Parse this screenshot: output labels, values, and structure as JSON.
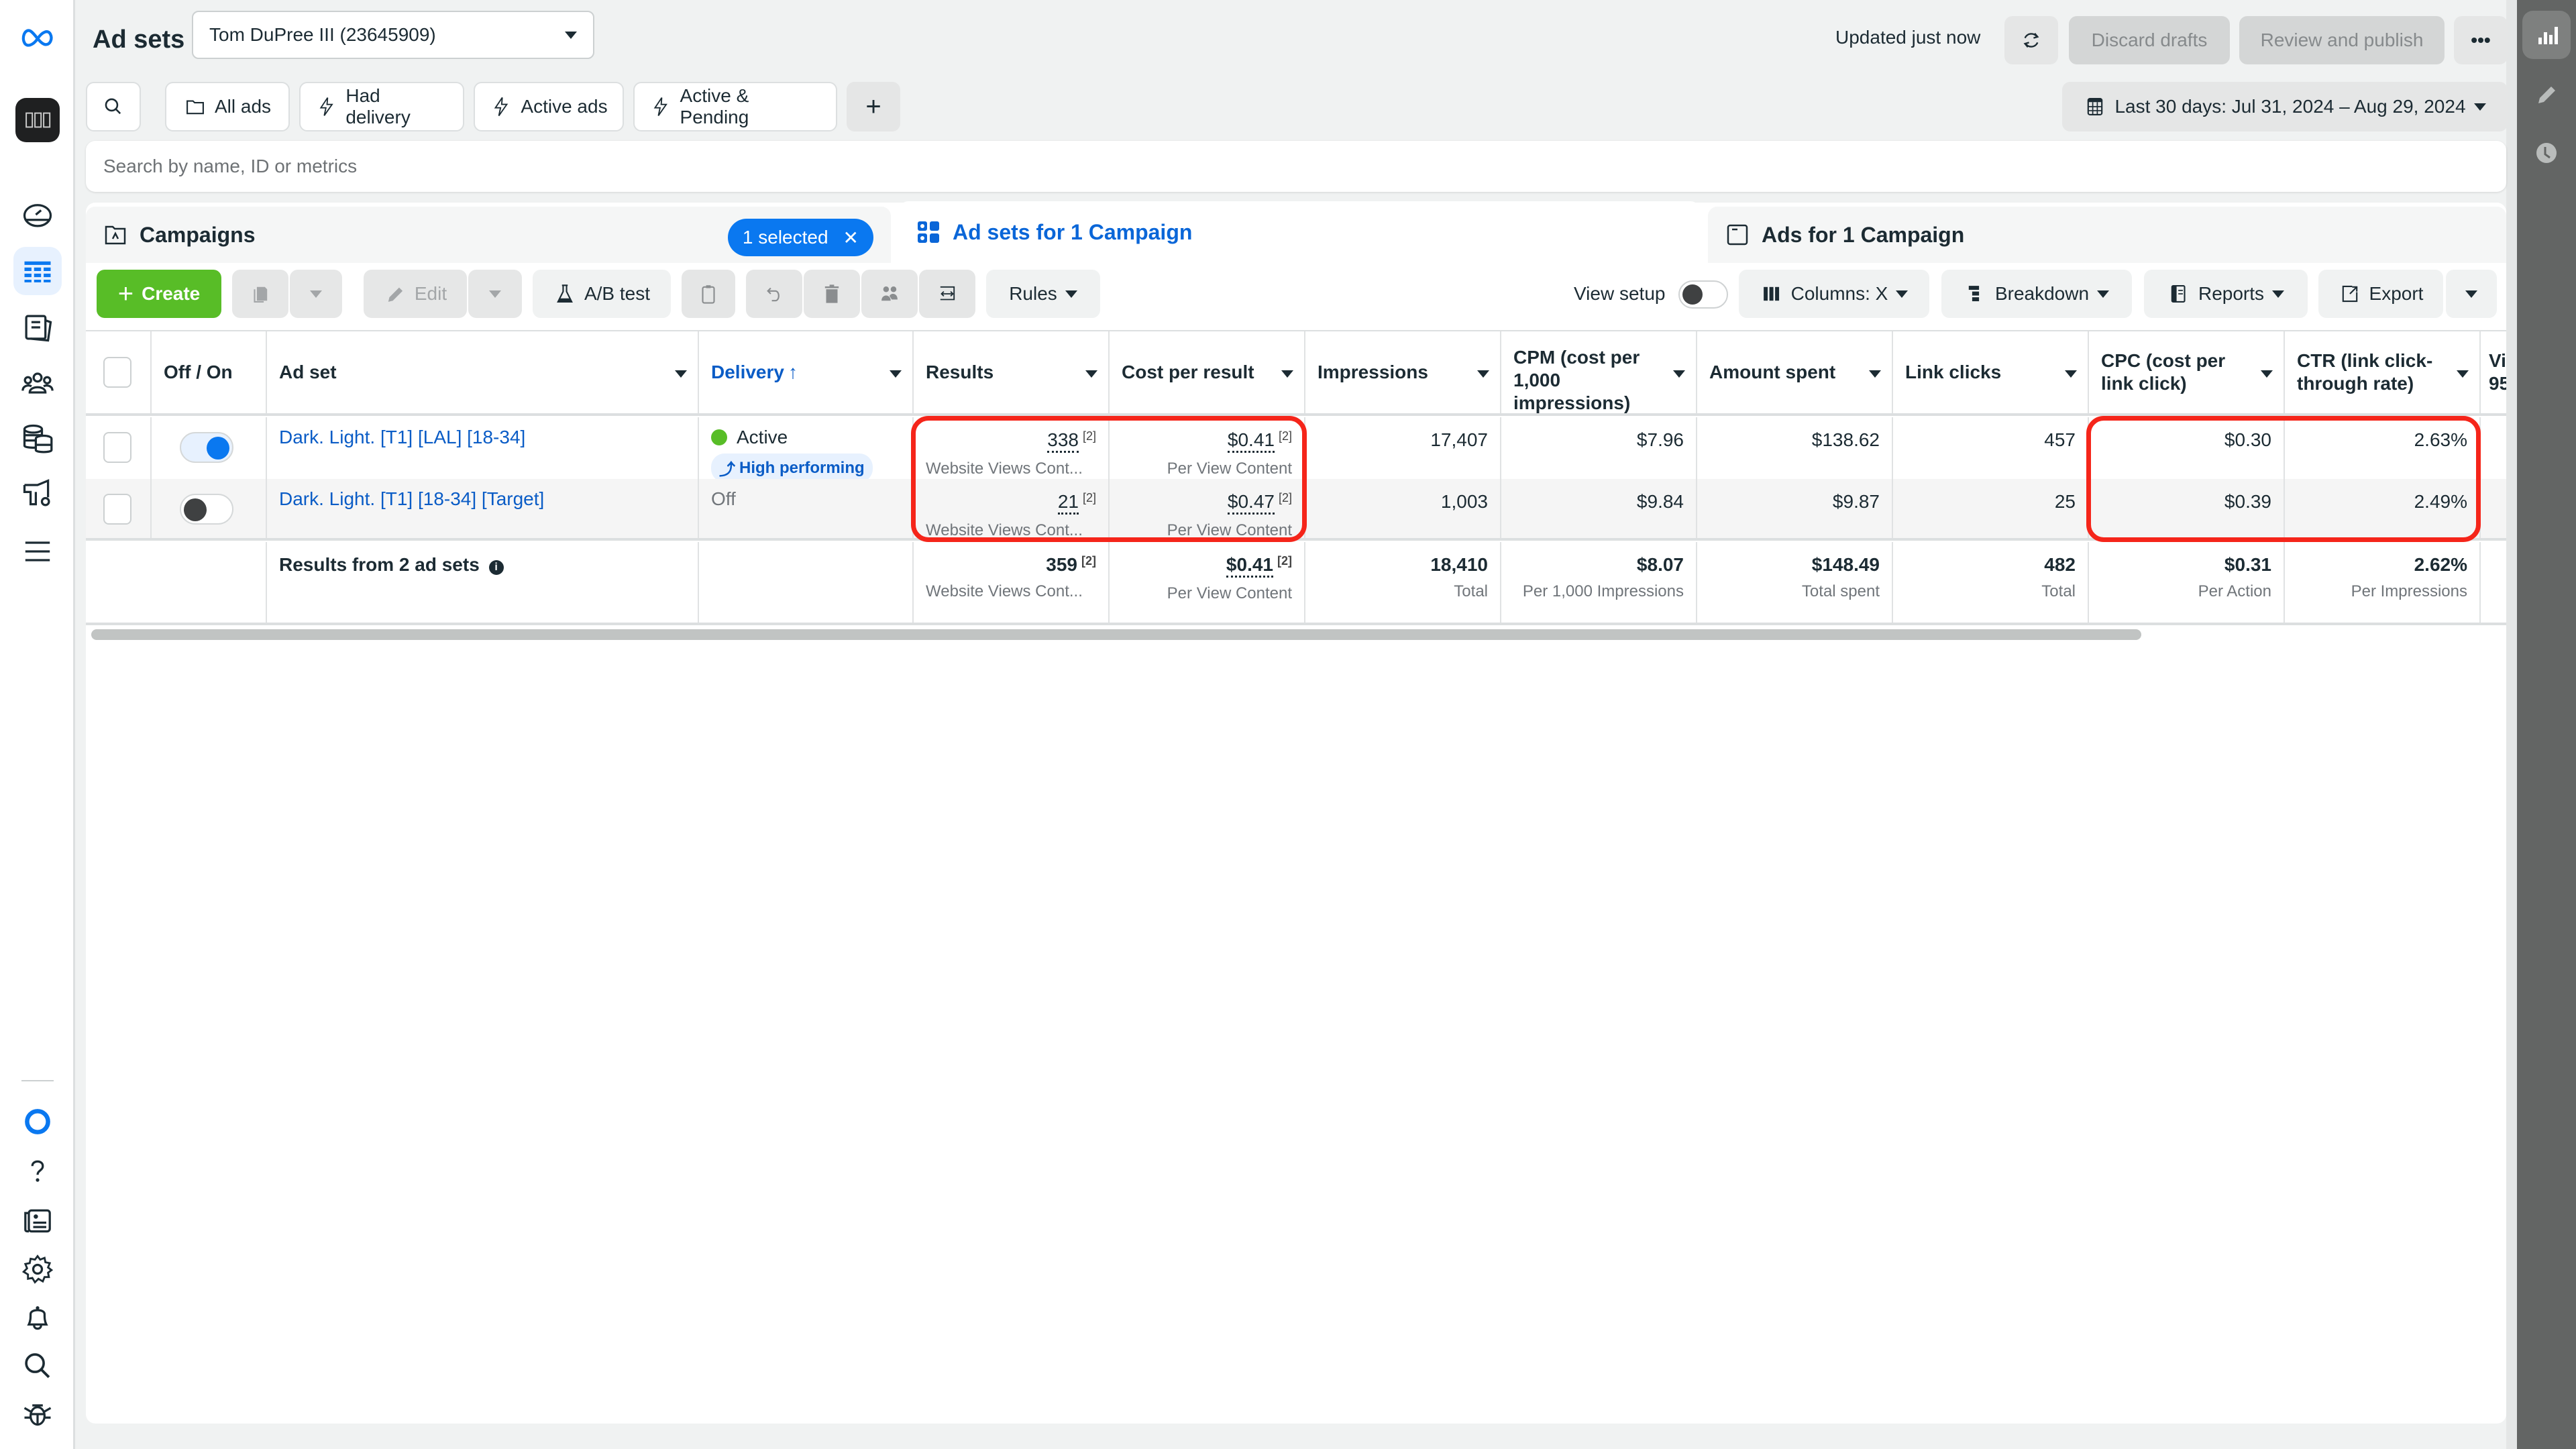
{
  "header": {
    "title": "Ad sets",
    "account": "Tom DuPree III (23645909)",
    "updated": "Updated just now",
    "discard_label": "Discard drafts",
    "publish_label": "Review and publish",
    "more_label": "•••"
  },
  "filters": {
    "items": [
      "All ads",
      "Had delivery",
      "Active ads",
      "Active & Pending"
    ],
    "add_label": "+",
    "date_range": "Last 30 days: Jul 31, 2024 – Aug 29, 2024"
  },
  "search": {
    "placeholder": "Search by name, ID or metrics"
  },
  "tabs": {
    "campaigns": "Campaigns",
    "selected_pill": "1 selected",
    "adsets": "Ad sets for 1 Campaign",
    "ads": "Ads for 1 Campaign"
  },
  "toolbar": {
    "create": "Create",
    "edit": "Edit",
    "ab_test": "A/B test",
    "rules": "Rules",
    "view_setup": "View setup",
    "columns": "Columns: X",
    "breakdown": "Breakdown",
    "reports": "Reports",
    "export": "Export"
  },
  "table": {
    "headers": {
      "offon": "Off / On",
      "adset": "Ad set",
      "delivery": "Delivery",
      "results": "Results",
      "cost": "Cost per result",
      "impressions": "Impressions",
      "cpm": "CPM (cost per 1,000 impressions)",
      "spent": "Amount spent",
      "clicks": "Link clicks",
      "cpc": "CPC (cost per link click)",
      "ctr": "CTR (link click-through rate)",
      "next": "Vi 95"
    },
    "rows": [
      {
        "name": "Dark. Light. [T1] [LAL] [18-34]",
        "on": true,
        "delivery": "Active",
        "badge": "High performing",
        "results": "338",
        "results_sup": "[2]",
        "results_sub": "Website Views Cont...",
        "cost": "$0.41",
        "cost_sup": "[2]",
        "cost_sub": "Per View Content",
        "impressions": "17,407",
        "cpm": "$7.96",
        "spent": "$138.62",
        "clicks": "457",
        "cpc": "$0.30",
        "ctr": "2.63%"
      },
      {
        "name": "Dark. Light. [T1] [18-34] [Target]",
        "on": false,
        "delivery": "Off",
        "results": "21",
        "results_sup": "[2]",
        "results_sub": "Website Views Cont...",
        "cost": "$0.47",
        "cost_sup": "[2]",
        "cost_sub": "Per View Content",
        "impressions": "1,003",
        "cpm": "$9.84",
        "spent": "$9.87",
        "clicks": "25",
        "cpc": "$0.39",
        "ctr": "2.49%"
      }
    ],
    "totals": {
      "label": "Results from 2 ad sets",
      "results": "359",
      "results_sup": "[2]",
      "results_sub": "Website Views Cont...",
      "cost": "$0.41",
      "cost_sup": "[2]",
      "cost_sub": "Per View Content",
      "impressions": "18,410",
      "impressions_sub": "Total",
      "cpm": "$8.07",
      "cpm_sub": "Per 1,000 Impressions",
      "spent": "$148.49",
      "spent_sub": "Total spent",
      "clicks": "482",
      "clicks_sub": "Total",
      "cpc": "$0.31",
      "cpc_sub": "Per Action",
      "ctr": "2.62%",
      "ctr_sub": "Per Impressions"
    }
  },
  "colors": {
    "accent": "#0a78f0",
    "create": "#58bd27",
    "highlight": "#f5251a",
    "active_dot": "#58bd27"
  }
}
